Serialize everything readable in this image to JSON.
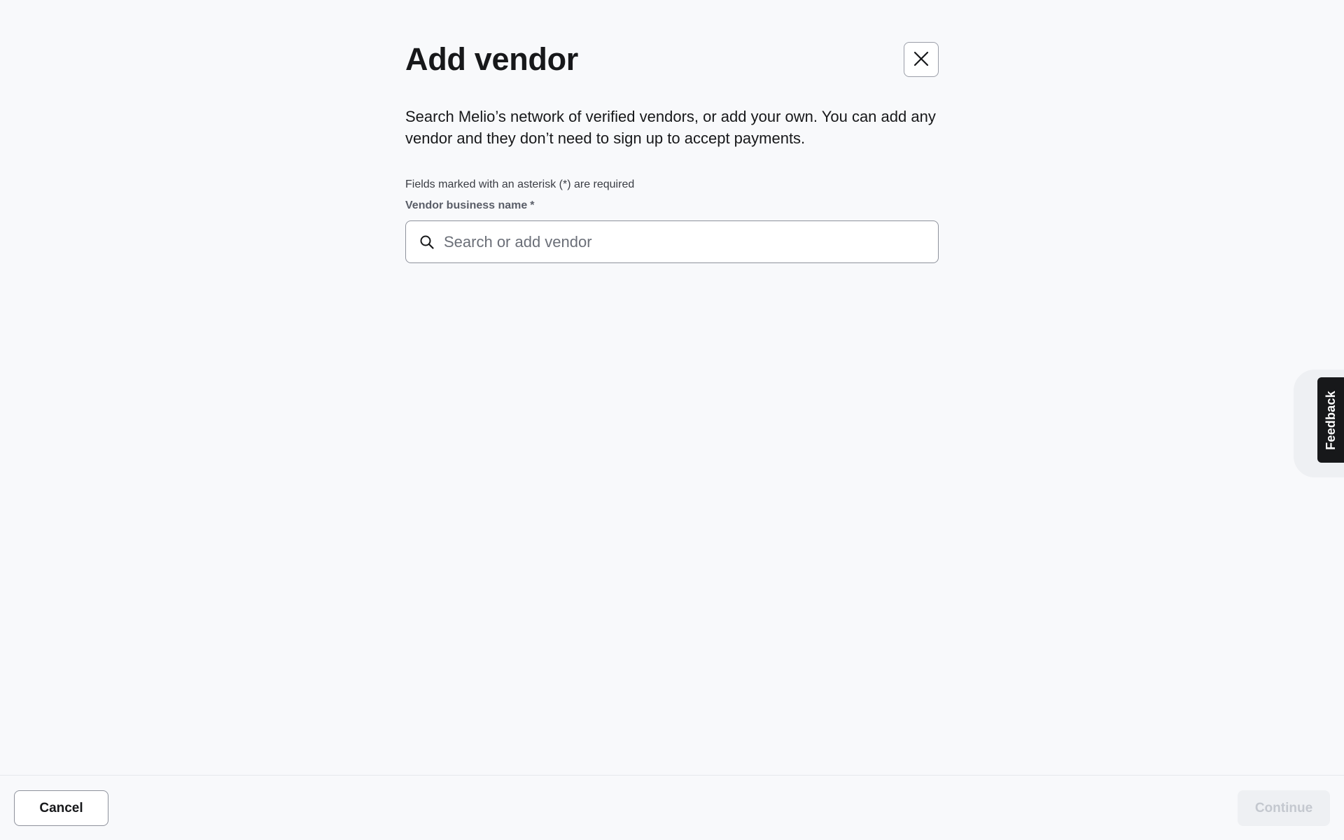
{
  "modal": {
    "title": "Add vendor",
    "description": "Search Melio’s network of verified vendors, or add your own. You can add any vendor and they don’t need to sign up to accept payments.",
    "required_note": "Fields marked with an asterisk (*) are required",
    "close_icon": "close-icon"
  },
  "vendor_field": {
    "label": "Vendor business name",
    "required_marker": "*",
    "placeholder": "Search or add vendor",
    "value": "",
    "icon": "search-icon"
  },
  "feedback": {
    "label": "Feedback"
  },
  "footer": {
    "cancel_label": "Cancel",
    "continue_label": "Continue",
    "continue_enabled": false
  },
  "colors": {
    "background": "#f8f9fb",
    "text_primary": "#17181a",
    "border": "#8e929c",
    "feedback_tab": "#17181a",
    "disabled_button_bg": "#eef0f3",
    "disabled_button_text": "#c4c8cf"
  }
}
